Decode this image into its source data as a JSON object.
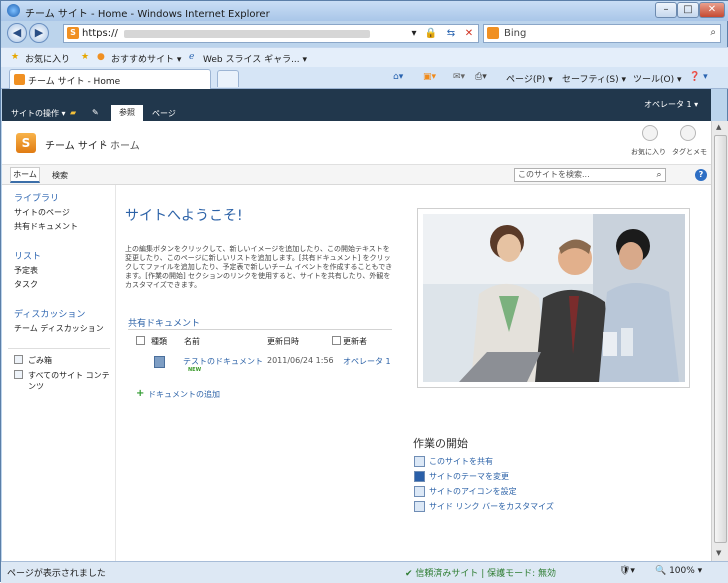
{
  "window": {
    "title": "チーム サイト - Home - Windows Internet Explorer",
    "min": "–",
    "max": "□",
    "close": "✕"
  },
  "address": {
    "url": "https://",
    "search_placeholder": "Bing"
  },
  "favorites_bar": {
    "favorites": "お気に入り",
    "suggested": "おすすめサイト ▾",
    "web_slice": "Web スライス ギャラ... ▾"
  },
  "tab": {
    "label": "チーム サイト - Home"
  },
  "commandbar": {
    "page": "ページ(P) ▾",
    "safety": "セーフティ(S) ▾",
    "tools": "ツール(O) ▾",
    "help": "❓ ▾"
  },
  "ribbon": {
    "site_actions": "サイトの操作 ▾",
    "browse": "参照",
    "page": "ページ",
    "user": "オペレータ 1 ▾"
  },
  "header": {
    "site_name": "チーム サイト",
    "separator": "›",
    "breadcrumb": "ホーム",
    "favorite": "お気に入り",
    "tags": "タグとメモ"
  },
  "topnav": {
    "home": "ホーム",
    "search": "検索",
    "search_placeholder": "このサイトを検索...",
    "help": "?"
  },
  "leftnav": {
    "library_head": "ライブラリ",
    "library_items": [
      "サイトのページ",
      "共有ドキュメント"
    ],
    "list_head": "リスト",
    "list_items": [
      "予定表",
      "タスク"
    ],
    "discussion_head": "ディスカッション",
    "discussion_items": [
      "チーム ディスカッション"
    ],
    "recycle": "ごみ箱",
    "all_content": "すべてのサイト コンテンツ"
  },
  "main": {
    "welcome": "サイトへようこそ!",
    "description": "上の編集ボタンをクリックして、新しいイメージを追加したり、この開始テキストを変更したり、このページに新しいリストを追加します。[共有ドキュメント] をクリックしてファイルを追加したり、予定表で新しいチーム イベントを作成することもできます。[作業の開始] セクションのリンクを使用すると、サイトを共有したり、外観をカスタマイズできます。",
    "shared_docs_head": "共有ドキュメント",
    "columns": {
      "type": "種類",
      "name": "名前",
      "modified": "更新日時",
      "modified_by": "更新者"
    },
    "rows": [
      {
        "name": "テストのドキュメント",
        "badge": "NEW",
        "modified": "2011/06/24 1:56",
        "modified_by": "オペレータ 1"
      }
    ],
    "add_doc": "ドキュメントの追加"
  },
  "get_started": {
    "heading": "作業の開始",
    "items": [
      "このサイトを共有",
      "サイトのテーマを変更",
      "サイトのアイコンを設定",
      "サイド リンク バーをカスタマイズ"
    ]
  },
  "status_bar": {
    "left": "ページが表示されました",
    "trusted": "✔ 信頼済みサイト | 保護モード: 無効",
    "zoom": "🔍 100% ▾"
  }
}
